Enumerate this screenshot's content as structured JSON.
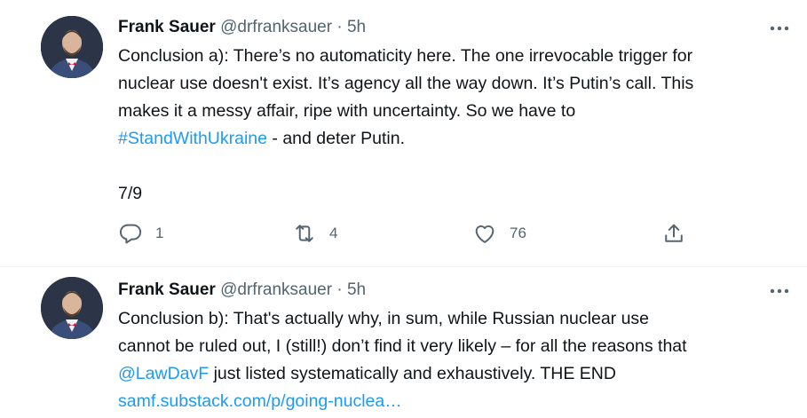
{
  "tweets": [
    {
      "author_name": "Frank Sauer",
      "handle": "@drfranksauer",
      "separator": "·",
      "time": "5h",
      "text_parts": {
        "p1": "Conclusion a): There’s no automaticity here. The one irrevocable trigger for",
        "p2": "nuclear use doesn't exist. It’s agency all the way down. It’s Putin’s call. This",
        "p3": "makes it a messy affair, ripe with uncertainty. So we have to",
        "hashtag": "#StandWithUkraine",
        "p4": " - and deter Putin.",
        "p5": "7/9"
      },
      "actions": {
        "reply_count": "1",
        "retweet_count": "4",
        "like_count": "76",
        "share_count": ""
      }
    },
    {
      "author_name": "Frank Sauer",
      "handle": "@drfranksauer",
      "separator": "·",
      "time": "5h",
      "text_parts": {
        "p1": "Conclusion b): That's actually why, in sum, while Russian nuclear use",
        "p2": "cannot be ruled out, I (still!) don’t find it very likely – for all the reasons that",
        "mention": "@LawDavF",
        "p3": " just listed systematically and exhaustively. THE END",
        "url": "samf.substack.com/p/going-nuclea…"
      }
    }
  ],
  "icons": [
    "more-icon",
    "reply-icon",
    "retweet-icon",
    "like-icon",
    "share-icon"
  ],
  "colors": {
    "link": "#1d9bf0",
    "meta": "#536471",
    "text": "#0f1419"
  }
}
